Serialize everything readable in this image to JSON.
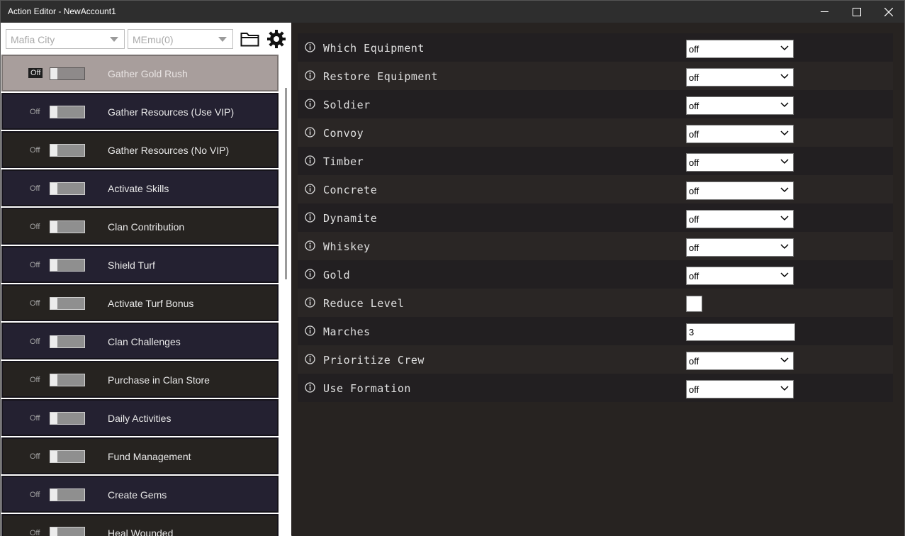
{
  "window": {
    "title": "Action Editor - NewAccount1"
  },
  "toolbar": {
    "game_select": "Mafia City",
    "emulator_select": "MEmu(0)"
  },
  "actions": [
    {
      "toggle": "Off",
      "label": "Gather Gold Rush",
      "selected": true
    },
    {
      "toggle": "Off",
      "label": "Gather Resources (Use VIP)"
    },
    {
      "toggle": "Off",
      "label": "Gather Resources (No VIP)"
    },
    {
      "toggle": "Off",
      "label": "Activate Skills"
    },
    {
      "toggle": "Off",
      "label": "Clan Contribution"
    },
    {
      "toggle": "Off",
      "label": "Shield Turf"
    },
    {
      "toggle": "Off",
      "label": "Activate Turf Bonus"
    },
    {
      "toggle": "Off",
      "label": "Clan Challenges"
    },
    {
      "toggle": "Off",
      "label": "Purchase in Clan Store"
    },
    {
      "toggle": "Off",
      "label": "Daily Activities"
    },
    {
      "toggle": "Off",
      "label": "Fund Management"
    },
    {
      "toggle": "Off",
      "label": "Create Gems"
    },
    {
      "toggle": "Off",
      "label": "Heal Wounded"
    }
  ],
  "settings": [
    {
      "label": "Which Equipment",
      "type": "select",
      "value": "off"
    },
    {
      "label": "Restore Equipment",
      "type": "select",
      "value": "off"
    },
    {
      "label": "Soldier",
      "type": "select",
      "value": "off"
    },
    {
      "label": "Convoy",
      "type": "select",
      "value": "off"
    },
    {
      "label": "Timber",
      "type": "select",
      "value": "off"
    },
    {
      "label": "Concrete",
      "type": "select",
      "value": "off"
    },
    {
      "label": "Dynamite",
      "type": "select",
      "value": "off"
    },
    {
      "label": "Whiskey",
      "type": "select",
      "value": "off"
    },
    {
      "label": "Gold",
      "type": "select",
      "value": "off"
    },
    {
      "label": "Reduce Level",
      "type": "checkbox",
      "value": false
    },
    {
      "label": "Marches",
      "type": "text",
      "value": "3"
    },
    {
      "label": "Prioritize Crew",
      "type": "select",
      "value": "off"
    },
    {
      "label": "Use Formation",
      "type": "select",
      "value": "off"
    }
  ],
  "icons": {
    "info": "info-icon",
    "folder": "folder-icon",
    "gear": "gear-icon"
  }
}
